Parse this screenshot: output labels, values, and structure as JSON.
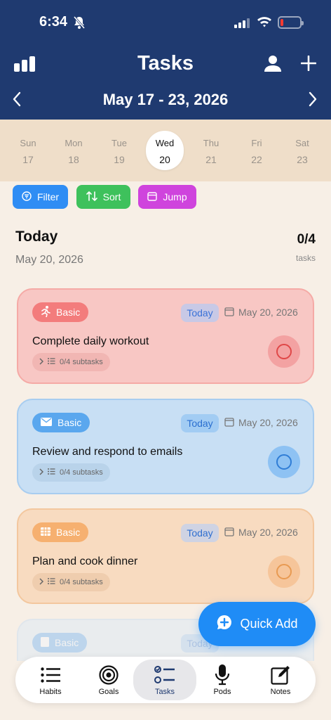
{
  "status_bar": {
    "time": "6:34"
  },
  "header": {
    "title": "Tasks",
    "date_range": "May 17 - 23, 2026"
  },
  "week": {
    "days": [
      {
        "name": "Sun",
        "date": "17"
      },
      {
        "name": "Mon",
        "date": "18"
      },
      {
        "name": "Tue",
        "date": "19"
      },
      {
        "name": "Wed",
        "date": "20"
      },
      {
        "name": "Thu",
        "date": "21"
      },
      {
        "name": "Fri",
        "date": "22"
      },
      {
        "name": "Sat",
        "date": "23"
      }
    ],
    "selected": "Wed"
  },
  "toolbar": {
    "filter_label": "Filter",
    "sort_label": "Sort",
    "jump_label": "Jump"
  },
  "section": {
    "title": "Today",
    "date": "May 20, 2026",
    "count": "0/4",
    "count_label": "tasks"
  },
  "tasks": [
    {
      "tag": "Basic",
      "tag_icon": "runner-icon",
      "pill": "Today",
      "date": "May 20, 2026",
      "title": "Complete daily workout",
      "subtasks": "0/4 subtasks",
      "color": "#f37c7c"
    },
    {
      "tag": "Basic",
      "tag_icon": "envelope-icon",
      "pill": "Today",
      "date": "May 20, 2026",
      "title": "Review and respond to emails",
      "subtasks": "0/4 subtasks",
      "color": "#5aa7ee"
    },
    {
      "tag": "Basic",
      "tag_icon": "grid-icon",
      "pill": "Today",
      "date": "May 20, 2026",
      "title": "Plan and cook dinner",
      "subtasks": "0/4 subtasks",
      "color": "#f6b070"
    },
    {
      "tag": "Basic",
      "pill": "Today"
    }
  ],
  "quick_add": {
    "label": "Quick Add"
  },
  "nav": [
    {
      "label": "Habits",
      "icon": "list-icon"
    },
    {
      "label": "Goals",
      "icon": "target-icon"
    },
    {
      "label": "Tasks",
      "icon": "checklist-icon",
      "active": true
    },
    {
      "label": "Pods",
      "icon": "microphone-icon"
    },
    {
      "label": "Notes",
      "icon": "note-edit-icon"
    }
  ],
  "colors": {
    "header": "#1f3a70",
    "accent": "#1f8cf6",
    "filter": "#2f8df4",
    "sort": "#3ec15c",
    "jump": "#cf44dd"
  }
}
